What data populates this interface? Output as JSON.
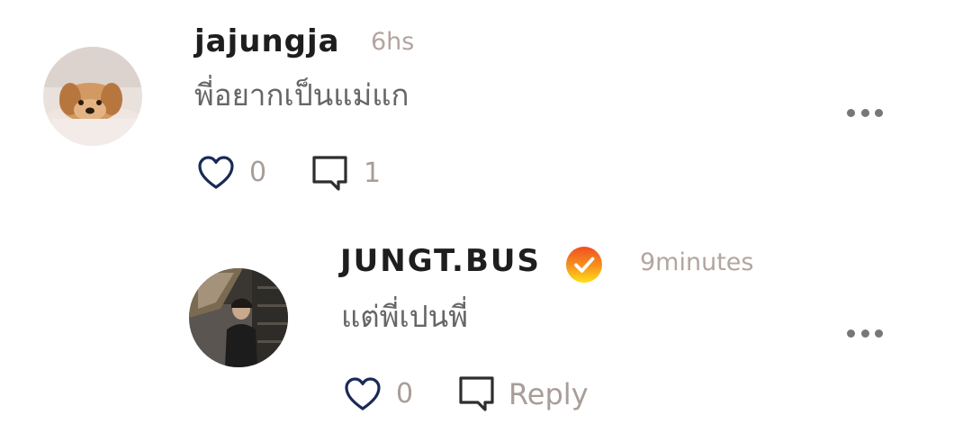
{
  "comments": [
    {
      "username": "jajungja",
      "timestamp": "6hs",
      "text": "พี่อยากเป็นแม่แก",
      "like_count": "0",
      "reply_count": "1",
      "avatar_icon": "puppy-avatar",
      "more_icon": "more-options-icon"
    }
  ],
  "replies": [
    {
      "username": "JUNGT.BUS",
      "verified": true,
      "timestamp": "9minutes",
      "text": "แต่พี่เปนพี่",
      "like_count": "0",
      "reply_label": "Reply",
      "avatar_icon": "person-avatar",
      "more_icon": "more-options-icon"
    }
  ],
  "colors": {
    "username": "#1e1e1e",
    "timestamp": "#b3a59f",
    "comment_text": "#666666",
    "icon_dark": "#1a2a55",
    "count_text": "#a89d98",
    "verified_orange": "#f28c1e",
    "verified_yellow": "#ffd21e"
  }
}
